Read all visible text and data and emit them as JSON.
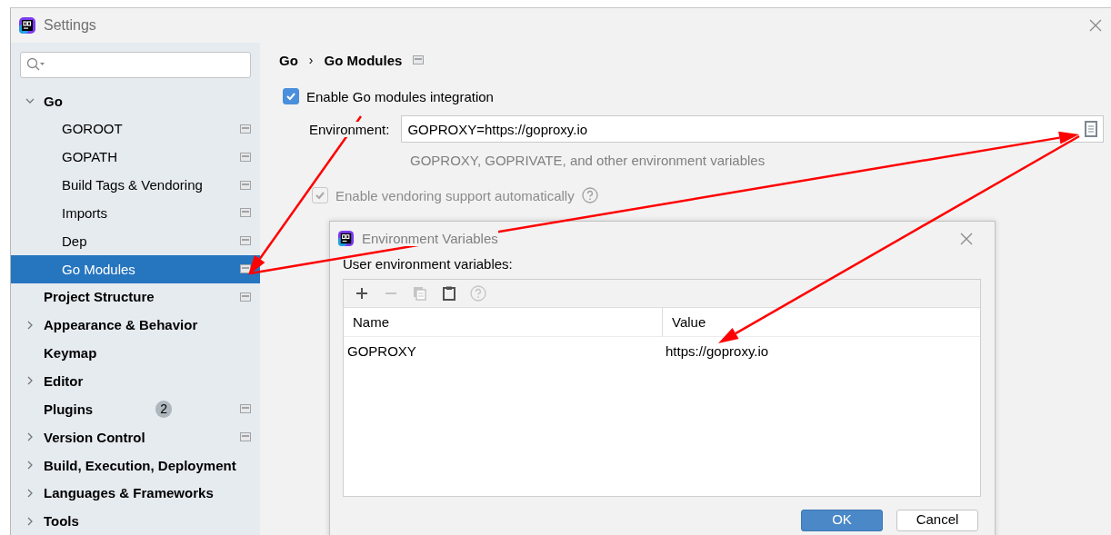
{
  "window": {
    "title": "Settings"
  },
  "sidebar": {
    "items": [
      {
        "label": "Go",
        "expandable": true,
        "expanded": true,
        "selected": false,
        "project_icon": false,
        "children": [
          {
            "label": "GOROOT",
            "selected": false,
            "project_icon": true
          },
          {
            "label": "GOPATH",
            "selected": false,
            "project_icon": true
          },
          {
            "label": "Build Tags & Vendoring",
            "selected": false,
            "project_icon": true
          },
          {
            "label": "Imports",
            "selected": false,
            "project_icon": true
          },
          {
            "label": "Dep",
            "selected": false,
            "project_icon": true
          },
          {
            "label": "Go Modules",
            "selected": true,
            "project_icon": true
          }
        ]
      },
      {
        "label": "Project Structure",
        "expandable": false,
        "expanded": false,
        "selected": false,
        "project_icon": true
      },
      {
        "label": "Appearance & Behavior",
        "expandable": true,
        "expanded": false,
        "selected": false,
        "project_icon": false
      },
      {
        "label": "Keymap",
        "expandable": false,
        "expanded": false,
        "selected": false,
        "project_icon": false
      },
      {
        "label": "Editor",
        "expandable": true,
        "expanded": false,
        "selected": false,
        "project_icon": false
      },
      {
        "label": "Plugins",
        "expandable": false,
        "expanded": false,
        "selected": false,
        "project_icon": true,
        "badge": "2"
      },
      {
        "label": "Version Control",
        "expandable": true,
        "expanded": false,
        "selected": false,
        "project_icon": true
      },
      {
        "label": "Build, Execution, Deployment",
        "expandable": true,
        "expanded": false,
        "selected": false,
        "project_icon": false
      },
      {
        "label": "Languages & Frameworks",
        "expandable": true,
        "expanded": false,
        "selected": false,
        "project_icon": false
      },
      {
        "label": "Tools",
        "expandable": true,
        "expanded": false,
        "selected": false,
        "project_icon": false
      }
    ]
  },
  "breadcrumb": {
    "items": [
      "Go",
      "Go Modules"
    ],
    "separator": "›"
  },
  "modules_checkbox": {
    "label": "Enable Go modules integration",
    "checked": true,
    "disabled": false
  },
  "environment": {
    "label": "Environment:",
    "value": "GOPROXY=https://goproxy.io",
    "hint": "GOPROXY, GOPRIVATE, and other environment variables"
  },
  "vendoring_checkbox": {
    "label": "Enable vendoring support automatically",
    "checked": true,
    "disabled": true
  },
  "dialog": {
    "title": "Environment Variables",
    "label": "User environment variables:",
    "toolbar": [
      {
        "kind": "add",
        "disabled": false
      },
      {
        "kind": "remove",
        "disabled": true
      },
      {
        "kind": "copy",
        "disabled": true
      },
      {
        "kind": "paste",
        "disabled": false
      },
      {
        "kind": "help",
        "disabled": true
      }
    ],
    "columns": [
      "Name",
      "Value"
    ],
    "rows": [
      [
        "GOPROXY",
        "https://goproxy.io"
      ]
    ],
    "buttons": [
      {
        "label": "OK",
        "kind": "primary"
      },
      {
        "label": "Cancel",
        "kind": "secondary"
      }
    ]
  }
}
